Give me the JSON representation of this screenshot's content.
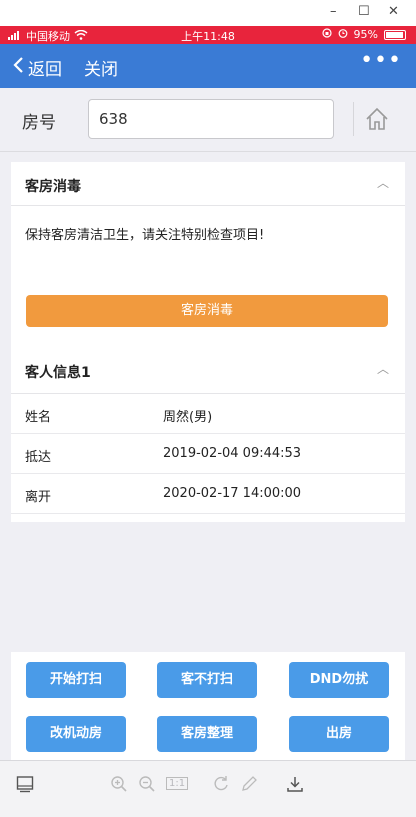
{
  "window": {
    "controls": [
      "–",
      "☐",
      "✕"
    ]
  },
  "status_bar": {
    "carrier": "中国移动",
    "time": "上午11:48",
    "battery": "95%",
    "battery_level": 0.95
  },
  "nav": {
    "back_label": "返回",
    "close_label": "关闭",
    "more_label": "•••"
  },
  "room": {
    "label": "房号",
    "value": "638"
  },
  "disinfect": {
    "title": "客房消毒",
    "notice": "保持客房清洁卫生，请关注特别检查项目!",
    "button_label": "客房消毒"
  },
  "guest": {
    "title": "客人信息1",
    "rows": [
      {
        "label": "姓名",
        "value": "周然(男)"
      },
      {
        "label": "抵达",
        "value": "2019-02-04 09:44:53"
      },
      {
        "label": "离开",
        "value": "2020-02-17 14:00:00"
      }
    ]
  },
  "actions": [
    {
      "label": "开始打扫"
    },
    {
      "label": "客不打扫"
    },
    {
      "label": "DND勿扰"
    },
    {
      "label": "改机动房"
    },
    {
      "label": "客房整理"
    },
    {
      "label": "出房"
    }
  ],
  "toolbar": {
    "page_label": "1:1"
  },
  "colors": {
    "accent": "#3a7bd5",
    "status": "#e8243c",
    "orange": "#f19a3e",
    "button_blue": "#4a9be8"
  }
}
